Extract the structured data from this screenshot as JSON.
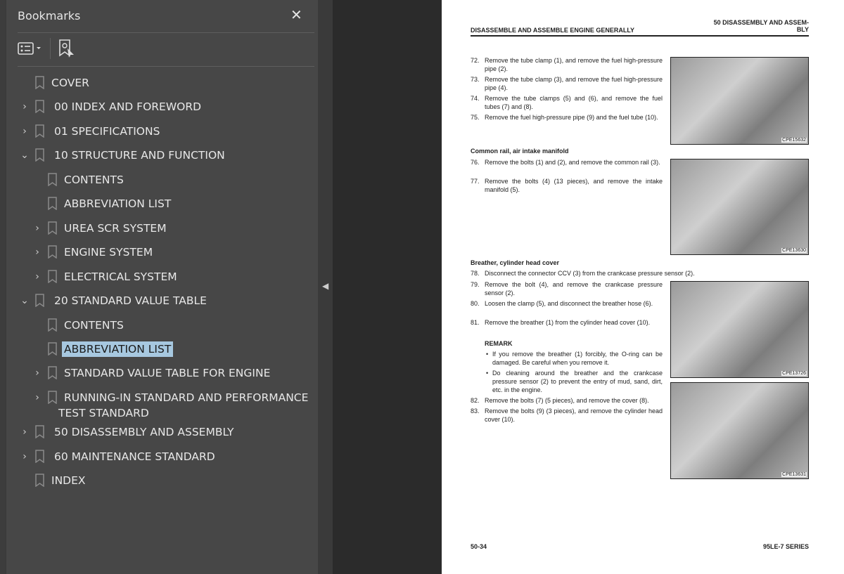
{
  "panel": {
    "title": "Bookmarks",
    "close": "✕"
  },
  "bookmarks": [
    {
      "label": "COVER",
      "level": 0,
      "expander": "none"
    },
    {
      "label": "00 INDEX AND FOREWORD",
      "level": 0,
      "expander": "collapsed"
    },
    {
      "label": "01 SPECIFICATIONS",
      "level": 0,
      "expander": "collapsed"
    },
    {
      "label": "10 STRUCTURE AND FUNCTION",
      "level": 0,
      "expander": "expanded"
    },
    {
      "label": "CONTENTS",
      "level": 1,
      "expander": "none"
    },
    {
      "label": "ABBREVIATION LIST",
      "level": 1,
      "expander": "none"
    },
    {
      "label": "UREA SCR SYSTEM",
      "level": 1,
      "expander": "collapsed"
    },
    {
      "label": "ENGINE SYSTEM",
      "level": 1,
      "expander": "collapsed"
    },
    {
      "label": "ELECTRICAL SYSTEM",
      "level": 1,
      "expander": "collapsed"
    },
    {
      "label": "20 STANDARD VALUE TABLE",
      "level": 0,
      "expander": "expanded"
    },
    {
      "label": "CONTENTS",
      "level": 1,
      "expander": "none"
    },
    {
      "label": "ABBREVIATION LIST",
      "level": 1,
      "expander": "none",
      "selected": true
    },
    {
      "label": "STANDARD VALUE TABLE FOR ENGINE",
      "level": 1,
      "expander": "collapsed"
    },
    {
      "label": "RUNNING-IN STANDARD AND PERFORMANCE",
      "label2": "TEST STANDARD",
      "level": 1,
      "expander": "collapsed"
    },
    {
      "label": "50 DISASSEMBLY AND ASSEMBLY",
      "level": 0,
      "expander": "collapsed"
    },
    {
      "label": "60 MAINTENANCE STANDARD",
      "level": 0,
      "expander": "collapsed"
    },
    {
      "label": "INDEX",
      "level": 0,
      "expander": "none"
    }
  ],
  "page": {
    "header_left": "DISASSEMBLE AND ASSEMBLE ENGINE GENERALLY",
    "header_right1": "50 DISASSEMBLY AND ASSEM-",
    "header_right2": "BLY",
    "steps": [
      {
        "n": "72.",
        "t": "Remove the tube clamp (1), and remove the fuel high-pressure pipe (2)."
      },
      {
        "n": "73.",
        "t": "Remove the tube clamp (3), and remove the fuel high-pressure pipe (4)."
      },
      {
        "n": "74.",
        "t": "Remove the tube clamps (5) and (6), and remove the fuel tubes (7) and (8)."
      },
      {
        "n": "75.",
        "t": "Remove the fuel high-pressure pipe (9) and the fuel tube (10)."
      },
      {
        "n": "76.",
        "t": "Remove the bolts (1) and (2), and remove the common rail (3)."
      },
      {
        "n": "77.",
        "t": "Remove the bolts (4) (13 pieces), and remove the intake manifold (5)."
      },
      {
        "n": "78.",
        "t": "Disconnect the connector CCV (3) from the crankcase pressure sensor (2)."
      },
      {
        "n": "79.",
        "t": "Remove the bolt (4), and remove the crankcase pressure sensor (2)."
      },
      {
        "n": "80.",
        "t": "Loosen the clamp (5), and disconnect the breather hose (6)."
      },
      {
        "n": "81.",
        "t": "Remove the breather (1) from the cylinder head cover (10)."
      },
      {
        "n": "82.",
        "t": "Remove the bolts (7) (5 pieces), and remove the cover (8)."
      },
      {
        "n": "83.",
        "t": "Remove the bolts (9) (3 pieces), and remove the cylinder head cover (10)."
      }
    ],
    "sub1": "Common rail, air intake manifold",
    "sub2": "Breather, cylinder head cover",
    "remark": "REMARK",
    "remark_items": [
      "If you remove the breather (1) forcibly, the O-ring can be damaged. Be careful when you remove it.",
      "Do cleaning around the breather and the crankcase pressure sensor (2) to prevent the entry of mud, sand, dirt, etc. in the engine."
    ],
    "figures": [
      "CPE15632",
      "CPE13630",
      "CPE13726",
      "CPE13631"
    ],
    "footer_left": "50-34",
    "footer_right": "95LE-7 SERIES"
  }
}
